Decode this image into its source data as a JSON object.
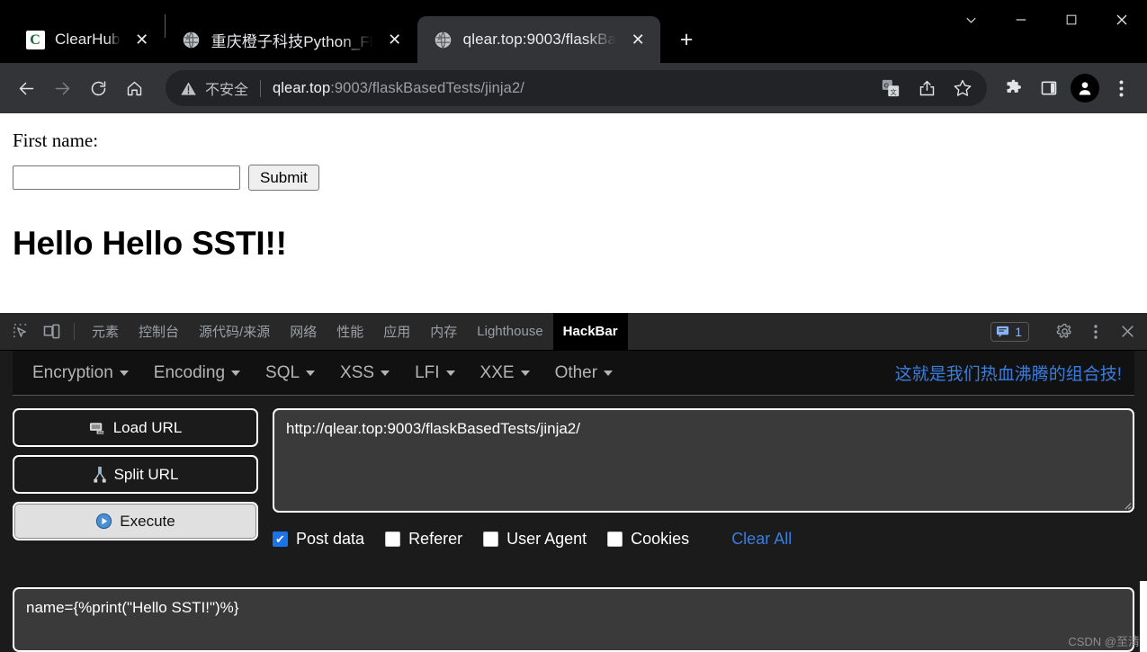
{
  "browser": {
    "tabs": [
      {
        "title": "ClearHub",
        "favicon": "clearhub-favicon",
        "active": false,
        "close_label": "✕"
      },
      {
        "title": "重庆橙子科技Python_Fl",
        "favicon": "globe-icon",
        "active": false,
        "close_label": "✕"
      },
      {
        "title": "qlear.top:9003/flaskBa",
        "favicon": "globe-icon",
        "active": true,
        "close_label": "✕"
      }
    ],
    "new_tab_label": "+",
    "window_controls": {
      "collapse": "chevron-down",
      "minimize": "—",
      "maximize": "❐",
      "close": "✕"
    },
    "nav": {
      "back": "←",
      "forward": "→",
      "reload": "↻",
      "home": "⌂"
    },
    "omnibox": {
      "security_label": "不安全",
      "url_host": "qlear.top",
      "url_rest": ":9003/flaskBasedTests/jinja2/",
      "url_full": "qlear.top:9003/flaskBasedTests/jinja2/"
    },
    "toolbar_icons": [
      "translate-icon",
      "share-icon",
      "bookmark-star-icon",
      "extensions-puzzle-icon",
      "side-panel-icon",
      "profile-avatar-icon",
      "chrome-menu-icon"
    ]
  },
  "page": {
    "first_name_label": "First name:",
    "first_name_value": "",
    "first_name_placeholder": "",
    "submit_label": "Submit",
    "heading": "Hello Hello SSTI!!"
  },
  "devtools": {
    "left_icons": [
      "inspect-element-icon",
      "device-toolbar-icon"
    ],
    "tabs": [
      {
        "label": "元素",
        "selected": false
      },
      {
        "label": "控制台",
        "selected": false
      },
      {
        "label": "源代码/来源",
        "selected": false
      },
      {
        "label": "网络",
        "selected": false
      },
      {
        "label": "性能",
        "selected": false
      },
      {
        "label": "应用",
        "selected": false
      },
      {
        "label": "内存",
        "selected": false
      },
      {
        "label": "Lighthouse",
        "selected": false
      },
      {
        "label": "HackBar",
        "selected": true
      }
    ],
    "issue_count": "1",
    "right_icons": [
      "issues-badge-icon",
      "settings-gear-icon",
      "devtools-menu-icon",
      "close-devtools-icon"
    ],
    "accent_blue": "#8ab4f8"
  },
  "hackbar": {
    "menus": [
      {
        "label": "Encryption"
      },
      {
        "label": "Encoding"
      },
      {
        "label": "SQL"
      },
      {
        "label": "XSS"
      },
      {
        "label": "LFI"
      },
      {
        "label": "XXE"
      },
      {
        "label": "Other"
      }
    ],
    "promo_link": "这就是我们热血沸腾的组合技!",
    "buttons": {
      "load_url": "Load URL",
      "split_url": "Split URL",
      "execute": "Execute"
    },
    "url_value": "http://qlear.top:9003/flaskBasedTests/jinja2/",
    "url_placeholder": "",
    "options": [
      {
        "label": "Post data",
        "checked": true,
        "mark": "✔"
      },
      {
        "label": "Referer",
        "checked": false,
        "mark": ""
      },
      {
        "label": "User Agent",
        "checked": false,
        "mark": ""
      },
      {
        "label": "Cookies",
        "checked": false,
        "mark": ""
      }
    ],
    "clear_all": "Clear All",
    "post_data_value": "name={%print(\"Hello SSTI!\")%}",
    "post_data_placeholder": "",
    "link_color": "#3b7ddd"
  },
  "watermark": "CSDN @至清"
}
